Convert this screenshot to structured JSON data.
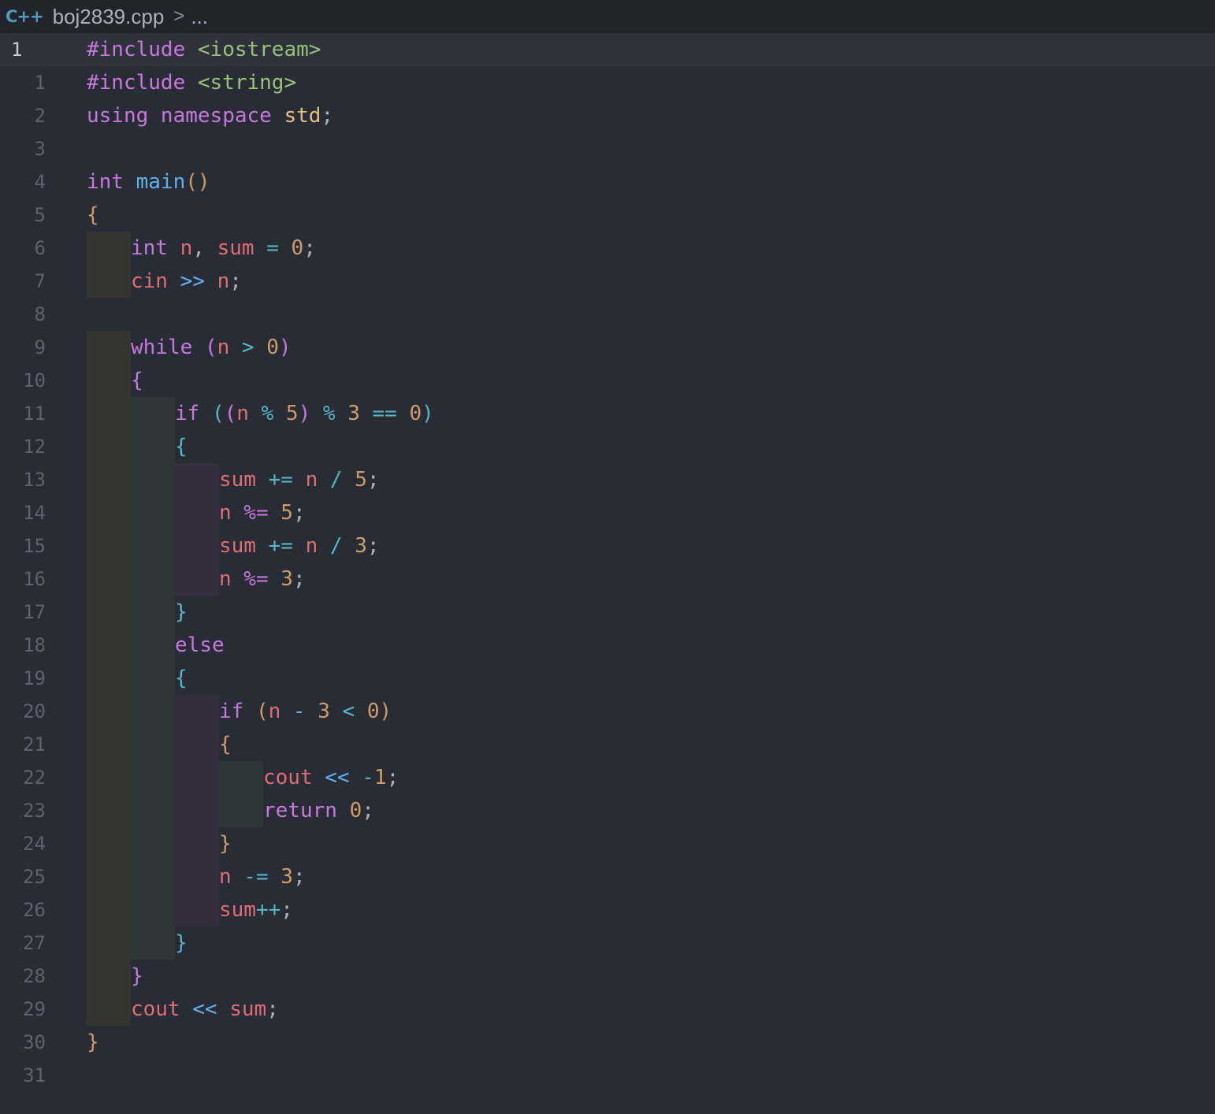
{
  "breadcrumb": {
    "language_icon": "C++",
    "file_name": "boj2839.cpp",
    "separator": ">",
    "trail": "..."
  },
  "sticky_line": {
    "number": "1",
    "tokens": [
      {
        "t": "#include ",
        "c": "kw"
      },
      {
        "t": "<iostream>",
        "c": "str"
      }
    ]
  },
  "lines": [
    {
      "n": "1",
      "indent": 0,
      "tokens": [
        {
          "t": "#include ",
          "c": "kw"
        },
        {
          "t": "<string>",
          "c": "str"
        }
      ]
    },
    {
      "n": "2",
      "indent": 0,
      "tokens": [
        {
          "t": "using ",
          "c": "kw"
        },
        {
          "t": "namespace ",
          "c": "kw"
        },
        {
          "t": "std",
          "c": "ty"
        },
        {
          "t": ";",
          "c": "pl"
        }
      ]
    },
    {
      "n": "3",
      "indent": 0,
      "tokens": []
    },
    {
      "n": "4",
      "indent": 0,
      "tokens": [
        {
          "t": "int ",
          "c": "kw"
        },
        {
          "t": "main",
          "c": "fn"
        },
        {
          "t": "()",
          "c": "br1"
        }
      ]
    },
    {
      "n": "5",
      "indent": 0,
      "tokens": [
        {
          "t": "{",
          "c": "br1"
        }
      ]
    },
    {
      "n": "6",
      "indent": 1,
      "tokens": [
        {
          "t": "int ",
          "c": "kw"
        },
        {
          "t": "n",
          "c": "var"
        },
        {
          "t": ", ",
          "c": "pl"
        },
        {
          "t": "sum",
          "c": "var"
        },
        {
          "t": " = ",
          "c": "op"
        },
        {
          "t": "0",
          "c": "num"
        },
        {
          "t": ";",
          "c": "pl"
        }
      ]
    },
    {
      "n": "7",
      "indent": 1,
      "tokens": [
        {
          "t": "cin",
          "c": "var"
        },
        {
          "t": " >> ",
          "c": "fn"
        },
        {
          "t": "n",
          "c": "var"
        },
        {
          "t": ";",
          "c": "pl"
        }
      ]
    },
    {
      "n": "8",
      "indent": 0,
      "tokens": []
    },
    {
      "n": "9",
      "indent": 1,
      "tokens": [
        {
          "t": "while ",
          "c": "kw"
        },
        {
          "t": "(",
          "c": "br2"
        },
        {
          "t": "n",
          "c": "var"
        },
        {
          "t": " > ",
          "c": "op"
        },
        {
          "t": "0",
          "c": "num"
        },
        {
          "t": ")",
          "c": "br2"
        }
      ]
    },
    {
      "n": "10",
      "indent": 1,
      "tokens": [
        {
          "t": "{",
          "c": "br2"
        }
      ]
    },
    {
      "n": "11",
      "indent": 2,
      "tokens": [
        {
          "t": "if ",
          "c": "kw"
        },
        {
          "t": "(",
          "c": "br3"
        },
        {
          "t": "(",
          "c": "br2"
        },
        {
          "t": "n",
          "c": "var"
        },
        {
          "t": " % ",
          "c": "op"
        },
        {
          "t": "5",
          "c": "num"
        },
        {
          "t": ")",
          "c": "br2"
        },
        {
          "t": " % ",
          "c": "op"
        },
        {
          "t": "3",
          "c": "num"
        },
        {
          "t": " == ",
          "c": "op"
        },
        {
          "t": "0",
          "c": "num"
        },
        {
          "t": ")",
          "c": "br3"
        }
      ]
    },
    {
      "n": "12",
      "indent": 2,
      "tokens": [
        {
          "t": "{",
          "c": "br3"
        }
      ]
    },
    {
      "n": "13",
      "indent": 3,
      "tokens": [
        {
          "t": "sum",
          "c": "var"
        },
        {
          "t": " += ",
          "c": "op"
        },
        {
          "t": "n",
          "c": "var"
        },
        {
          "t": " / ",
          "c": "op"
        },
        {
          "t": "5",
          "c": "num"
        },
        {
          "t": ";",
          "c": "pl"
        }
      ]
    },
    {
      "n": "14",
      "indent": 3,
      "tokens": [
        {
          "t": "n",
          "c": "var"
        },
        {
          "t": " %= ",
          "c": "kw"
        },
        {
          "t": "5",
          "c": "num"
        },
        {
          "t": ";",
          "c": "pl"
        }
      ]
    },
    {
      "n": "15",
      "indent": 3,
      "tokens": [
        {
          "t": "sum",
          "c": "var"
        },
        {
          "t": " += ",
          "c": "op"
        },
        {
          "t": "n",
          "c": "var"
        },
        {
          "t": " / ",
          "c": "op"
        },
        {
          "t": "3",
          "c": "num"
        },
        {
          "t": ";",
          "c": "pl"
        }
      ]
    },
    {
      "n": "16",
      "indent": 3,
      "tokens": [
        {
          "t": "n",
          "c": "var"
        },
        {
          "t": " %= ",
          "c": "kw"
        },
        {
          "t": "3",
          "c": "num"
        },
        {
          "t": ";",
          "c": "pl"
        }
      ]
    },
    {
      "n": "17",
      "indent": 2,
      "tokens": [
        {
          "t": "}",
          "c": "br3"
        }
      ]
    },
    {
      "n": "18",
      "indent": 2,
      "tokens": [
        {
          "t": "else",
          "c": "kw"
        }
      ]
    },
    {
      "n": "19",
      "indent": 2,
      "tokens": [
        {
          "t": "{",
          "c": "br3"
        }
      ]
    },
    {
      "n": "20",
      "indent": 3,
      "tokens": [
        {
          "t": "if ",
          "c": "kw"
        },
        {
          "t": "(",
          "c": "br1"
        },
        {
          "t": "n",
          "c": "var"
        },
        {
          "t": " - ",
          "c": "op"
        },
        {
          "t": "3",
          "c": "num"
        },
        {
          "t": " < ",
          "c": "op"
        },
        {
          "t": "0",
          "c": "num"
        },
        {
          "t": ")",
          "c": "br1"
        }
      ]
    },
    {
      "n": "21",
      "indent": 3,
      "tokens": [
        {
          "t": "{",
          "c": "br1"
        }
      ]
    },
    {
      "n": "22",
      "indent": 4,
      "tokens": [
        {
          "t": "cout",
          "c": "var"
        },
        {
          "t": " << ",
          "c": "fn"
        },
        {
          "t": "-",
          "c": "op"
        },
        {
          "t": "1",
          "c": "num"
        },
        {
          "t": ";",
          "c": "pl"
        }
      ]
    },
    {
      "n": "23",
      "indent": 4,
      "tokens": [
        {
          "t": "return ",
          "c": "kw"
        },
        {
          "t": "0",
          "c": "num"
        },
        {
          "t": ";",
          "c": "pl"
        }
      ]
    },
    {
      "n": "24",
      "indent": 3,
      "tokens": [
        {
          "t": "}",
          "c": "br1"
        }
      ]
    },
    {
      "n": "25",
      "indent": 3,
      "tokens": [
        {
          "t": "n",
          "c": "var"
        },
        {
          "t": " -= ",
          "c": "op"
        },
        {
          "t": "3",
          "c": "num"
        },
        {
          "t": ";",
          "c": "pl"
        }
      ]
    },
    {
      "n": "26",
      "indent": 3,
      "tokens": [
        {
          "t": "sum",
          "c": "var"
        },
        {
          "t": "++",
          "c": "op"
        },
        {
          "t": ";",
          "c": "pl"
        }
      ]
    },
    {
      "n": "27",
      "indent": 2,
      "tokens": [
        {
          "t": "}",
          "c": "br3"
        }
      ]
    },
    {
      "n": "28",
      "indent": 1,
      "tokens": [
        {
          "t": "}",
          "c": "br2"
        }
      ]
    },
    {
      "n": "29",
      "indent": 1,
      "tokens": [
        {
          "t": "cout",
          "c": "var"
        },
        {
          "t": " << ",
          "c": "fn"
        },
        {
          "t": "sum",
          "c": "var"
        },
        {
          "t": ";",
          "c": "pl"
        }
      ]
    },
    {
      "n": "30",
      "indent": 0,
      "tokens": [
        {
          "t": "}",
          "c": "br1"
        }
      ]
    },
    {
      "n": "31",
      "indent": 0,
      "tokens": []
    }
  ]
}
